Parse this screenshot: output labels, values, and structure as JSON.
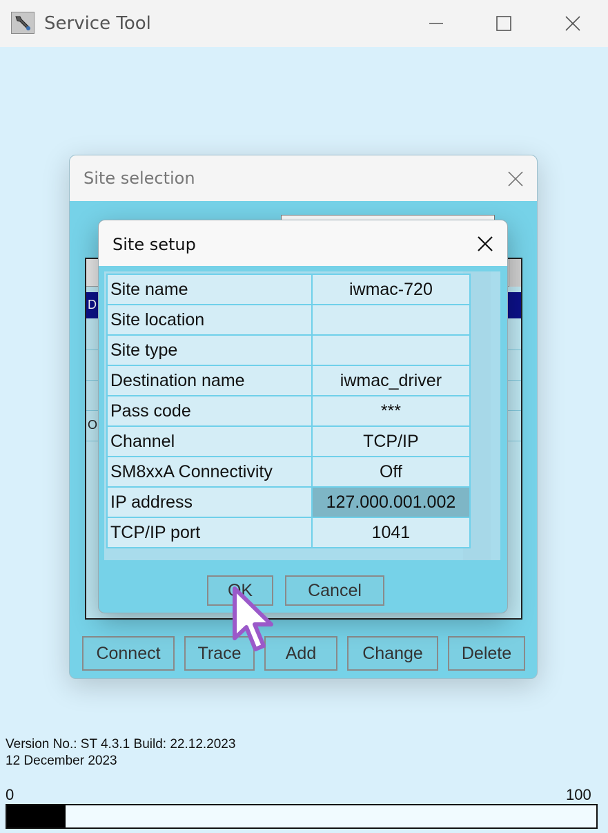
{
  "window": {
    "title": "Service Tool",
    "icon": "wrench-icon"
  },
  "site_selection": {
    "title": "Site selection",
    "list": {
      "selected_row_prefix": "D",
      "row_prefix": "O"
    },
    "buttons": {
      "connect": "Connect",
      "trace": "Trace",
      "add": "Add",
      "change": "Change",
      "delete": "Delete"
    }
  },
  "site_setup": {
    "title": "Site setup",
    "rows": [
      {
        "label": "Site name",
        "value": "iwmac-720"
      },
      {
        "label": "Site location",
        "value": ""
      },
      {
        "label": "Site type",
        "value": ""
      },
      {
        "label": "Destination name",
        "value": "iwmac_driver"
      },
      {
        "label": "Pass code",
        "value": "***"
      },
      {
        "label": "Channel",
        "value": "TCP/IP"
      },
      {
        "label": "SM8xxA Connectivity",
        "value": "Off"
      },
      {
        "label": "IP address",
        "value": "127.000.001.002"
      },
      {
        "label": "TCP/IP port",
        "value": "1041"
      }
    ],
    "ok_label": "OK",
    "cancel_label": "Cancel"
  },
  "footer": {
    "version_line": "Version No.: ST 4.3.1 Build: 22.12.2023",
    "date_line": "12 December 2023",
    "scale_min": "0",
    "scale_max": "100",
    "progress_fraction": 0.1
  },
  "colors": {
    "background": "#d9f0fb",
    "dialog_body": "#76d2e8",
    "selected_row": "#0c1088",
    "focused_cell": "#7eb6c6",
    "cursor": "#9b59c9"
  }
}
